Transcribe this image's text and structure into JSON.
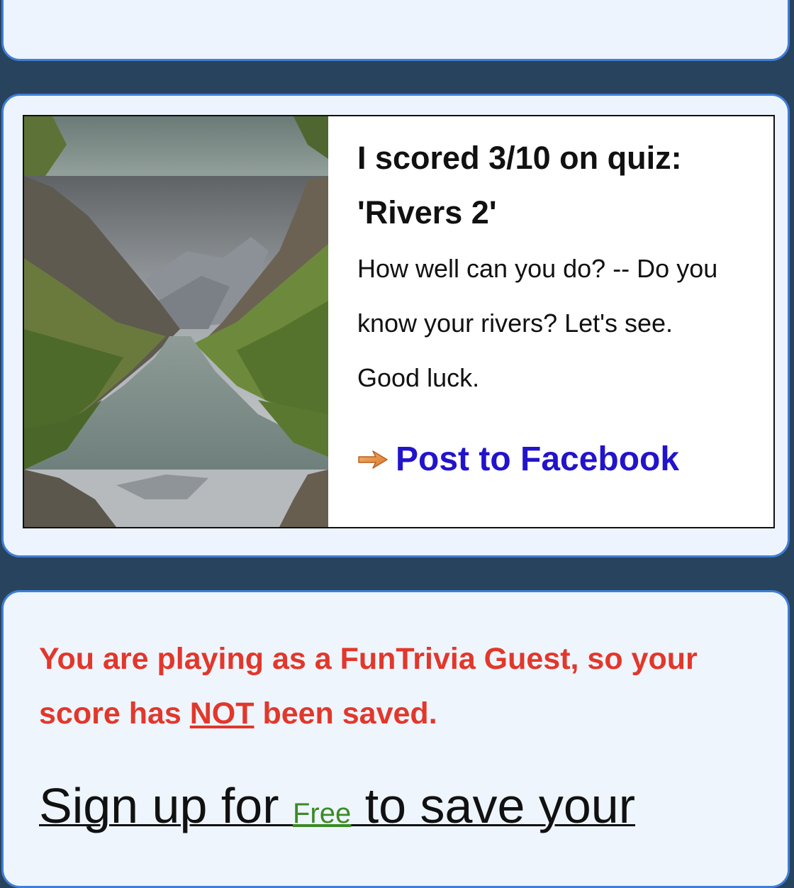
{
  "share": {
    "title_line1": "I scored 3/10 on quiz:",
    "title_line2": "'Rivers 2'",
    "description": "How well can you do? -- Do you know your rivers? Let's see. Good luck.",
    "image_icon": "river-canyon-photo",
    "facebook_icon": "arrow-right-icon",
    "facebook_label": "Post to Facebook"
  },
  "guest": {
    "warning_part1": "You are playing as a FunTrivia Guest, so your score has ",
    "warning_emphasis": "NOT",
    "warning_part2": " been saved.",
    "signup_prefix": "Sign up for ",
    "signup_free": "Free",
    "signup_suffix": " to save your"
  },
  "colors": {
    "page_bg": "#28435e",
    "panel_bg": "#edf4fd",
    "panel_border": "#3f7ed6",
    "warning": "#e2372b",
    "link": "#2213cc",
    "free": "#3b8a25"
  }
}
